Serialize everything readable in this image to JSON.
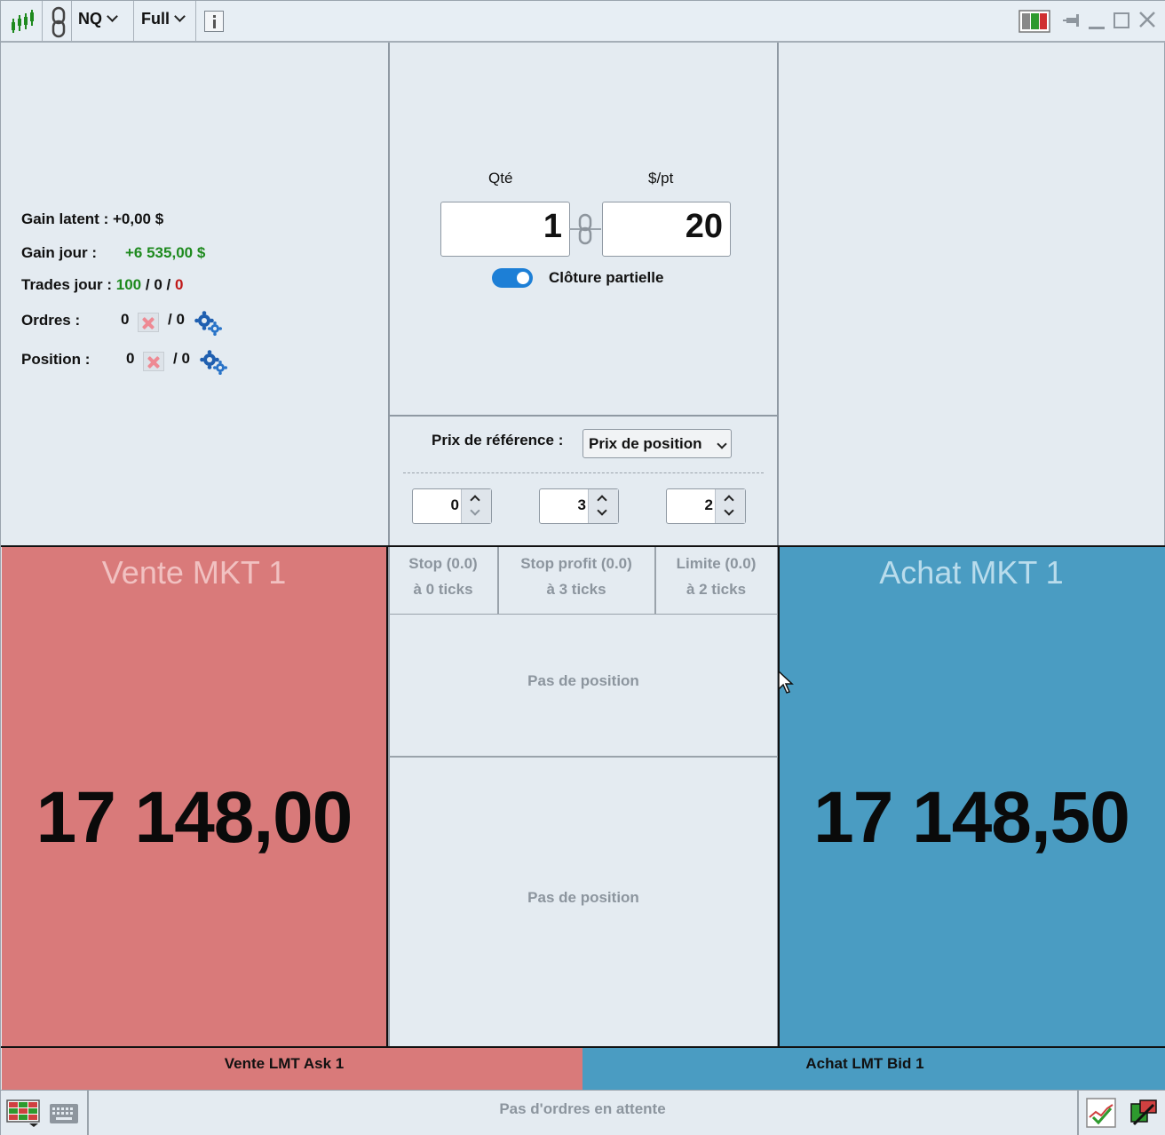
{
  "toolbar": {
    "symbol": "NQ",
    "mode": "Full",
    "icons": [
      "candlestick-chart-icon",
      "link-icon",
      "info-icon",
      "layout-colors-icon",
      "pin-icon",
      "minimize-icon",
      "maximize-icon",
      "close-icon"
    ]
  },
  "stats": {
    "gain_latent_label": "Gain latent :",
    "gain_latent_value": "+0,00 $",
    "gain_jour_label": "Gain jour :",
    "gain_jour_value": "+6 535,00 $",
    "trades_label": "Trades jour :",
    "trades_win": "100",
    "trades_sep1": "/",
    "trades_even": "0",
    "trades_sep2": "/",
    "trades_loss": "0",
    "orders_label": "Ordres :",
    "orders_count": "0",
    "orders_sep": "/ 0",
    "position_label": "Position :",
    "position_count": "0",
    "position_sep": "/ 0"
  },
  "order_entry": {
    "qty_label": "Qté",
    "qty_value": "1",
    "ppt_label": "$/pt",
    "ppt_value": "20",
    "partial_close_label": "Clôture partielle",
    "partial_close_on": true
  },
  "reference": {
    "label": "Prix de référence :",
    "selected": "Prix de position",
    "stop_ticks": "0",
    "profit_ticks": "3",
    "limit_ticks": "2"
  },
  "brackets": [
    {
      "title": "Stop (0.0)",
      "sub": "à 0 ticks"
    },
    {
      "title": "Stop profit (0.0)",
      "sub": "à 3 ticks"
    },
    {
      "title": "Limite (0.0)",
      "sub": "à 2 ticks"
    }
  ],
  "positions": {
    "upper_empty": "Pas de position",
    "lower_empty": "Pas de position"
  },
  "sell": {
    "title": "Vente MKT 1",
    "price": "17 148,00",
    "lmt_label": "Vente LMT Ask 1",
    "color": "#d97a7a"
  },
  "buy": {
    "title": "Achat MKT 1",
    "price": "17 148,50",
    "lmt_label": "Achat LMT Bid 1",
    "color": "#4a9cc2"
  },
  "status": {
    "pending": "Pas d'ordres en attente"
  }
}
